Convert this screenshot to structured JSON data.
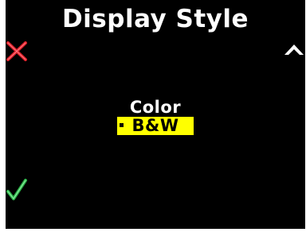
{
  "screen": {
    "title": "Display Style",
    "background_color": "#000000"
  },
  "controls": {
    "cancel_icon": "cross-icon",
    "cancel_color": "#e0202a",
    "up_icon": "chevron-up-icon",
    "up_color": "#ffffff",
    "confirm_icon": "checkmark-icon",
    "confirm_color": "#2db84a"
  },
  "menu": {
    "selected_index": 1,
    "highlight_color": "#ffff00",
    "items": [
      {
        "label": "Color"
      },
      {
        "label": "B&W"
      }
    ]
  }
}
